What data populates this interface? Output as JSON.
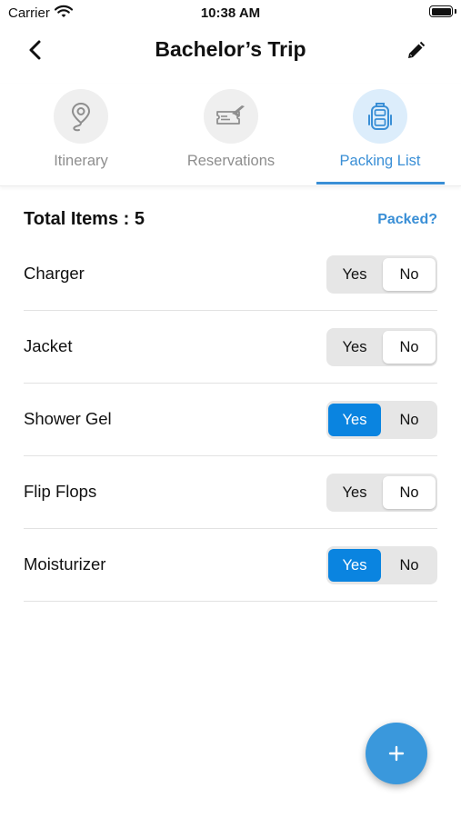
{
  "status_bar": {
    "carrier": "Carrier",
    "time": "10:38 AM"
  },
  "nav": {
    "title": "Bachelor’s Trip"
  },
  "tabs": [
    {
      "label": "Itinerary",
      "icon": "location-pin-icon",
      "active": false
    },
    {
      "label": "Reservations",
      "icon": "ticket-plane-icon",
      "active": false
    },
    {
      "label": "Packing List",
      "icon": "backpack-icon",
      "active": true
    }
  ],
  "summary": {
    "total_label": "Total Items : 5",
    "packed_link": "Packed?"
  },
  "items": [
    {
      "name": "Charger",
      "yes": "Yes",
      "no": "No",
      "packed": false
    },
    {
      "name": "Jacket",
      "yes": "Yes",
      "no": "No",
      "packed": false
    },
    {
      "name": "Shower Gel",
      "yes": "Yes",
      "no": "No",
      "packed": true
    },
    {
      "name": "Flip Flops",
      "yes": "Yes",
      "no": "No",
      "packed": false
    },
    {
      "name": "Moisturizer",
      "yes": "Yes",
      "no": "No",
      "packed": true
    }
  ],
  "colors": {
    "accent": "#3a8fd6",
    "toggle_active": "#0a84e0",
    "fab": "#3a98dc"
  }
}
